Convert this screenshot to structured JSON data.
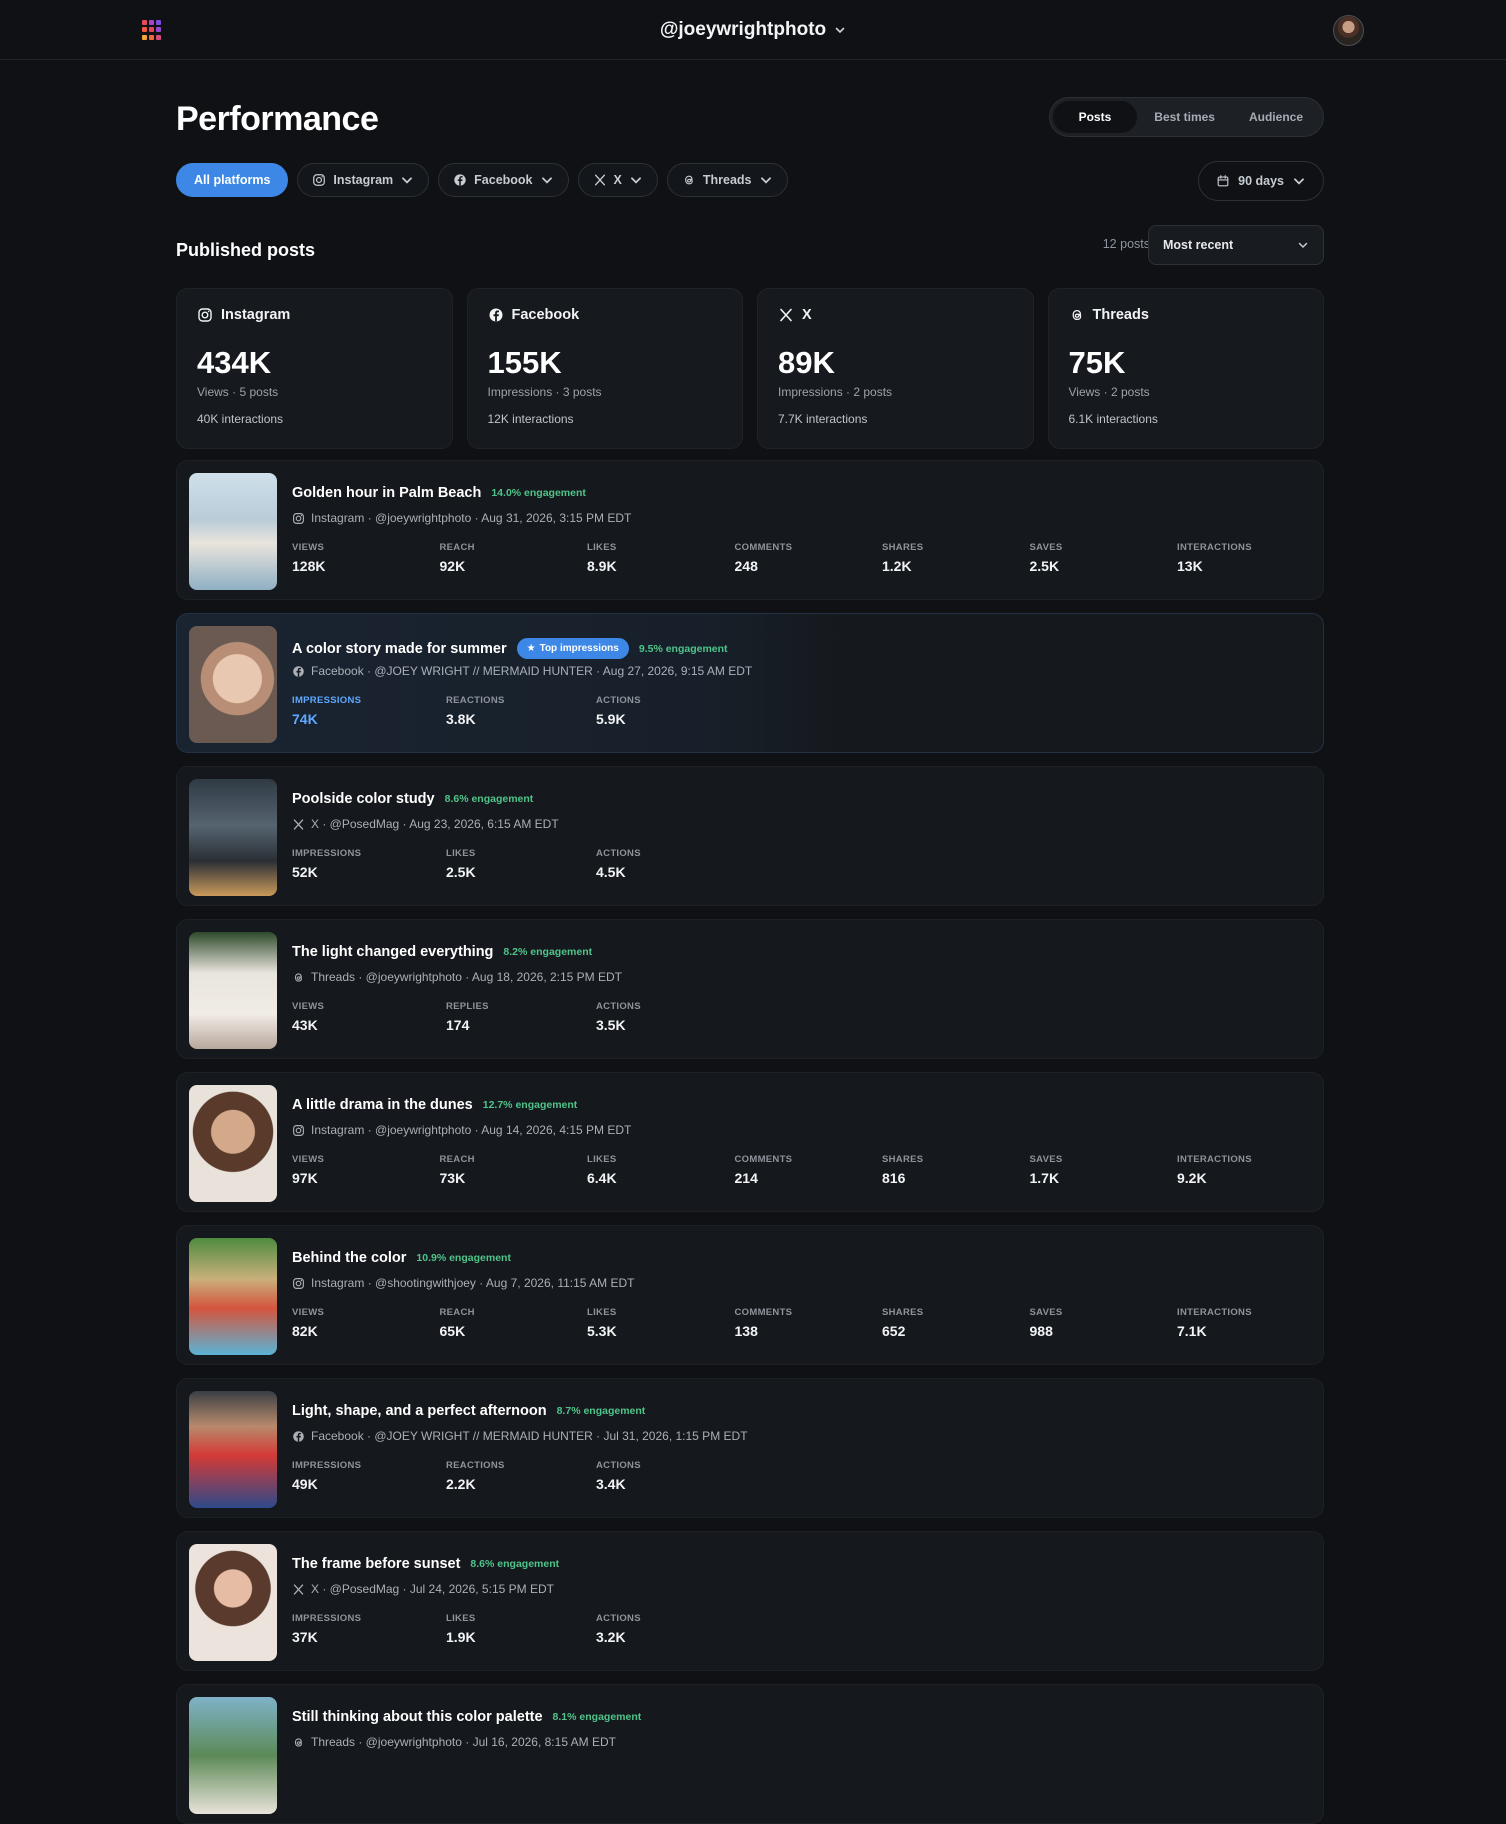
{
  "topbar": {
    "account": "@joeywrightphoto",
    "grid_colors": [
      "#e94a5b",
      "#a646c8",
      "#7a4de0",
      "#f1573f",
      "#e6425a",
      "#9847cf",
      "#f5a43a",
      "#ee6a3a",
      "#d9497a"
    ]
  },
  "page": {
    "title": "Performance",
    "tabs": [
      "Posts",
      "Best times",
      "Audience"
    ],
    "active_tab": "Posts",
    "filters": {
      "all": "All platforms",
      "instagram": "Instagram",
      "facebook": "Facebook",
      "x": "X",
      "threads": "Threads"
    },
    "date_range": "90 days",
    "section_title": "Published posts",
    "post_count": "12 posts",
    "sort": "Most recent"
  },
  "colors": {
    "accent": "#3d88e6",
    "engagement": "#4fc48a",
    "highlight": "#5ea8ff"
  },
  "summary": [
    {
      "platform": "Instagram",
      "icon": "instagram-icon",
      "value": "434K",
      "sub": "Views · 5 posts",
      "interactions": "40K interactions"
    },
    {
      "platform": "Facebook",
      "icon": "facebook-icon",
      "value": "155K",
      "sub": "Impressions · 3 posts",
      "interactions": "12K interactions"
    },
    {
      "platform": "X",
      "icon": "x-icon",
      "value": "89K",
      "sub": "Impressions · 2 posts",
      "interactions": "7.7K interactions"
    },
    {
      "platform": "Threads",
      "icon": "threads-icon",
      "value": "75K",
      "sub": "Views · 2 posts",
      "interactions": "6.1K interactions"
    }
  ],
  "posts": [
    {
      "title": "Golden hour in Palm Beach",
      "engagement": "14.0% engagement",
      "badge": "",
      "platform": "instagram",
      "meta": "Instagram · @joeywrightphoto · Aug 31, 2026, 3:15 PM EDT",
      "metrics": [
        [
          "VIEWS",
          "128K"
        ],
        [
          "REACH",
          "92K"
        ],
        [
          "LIKES",
          "8.9K"
        ],
        [
          "COMMENTS",
          "248"
        ],
        [
          "SHARES",
          "1.2K"
        ],
        [
          "SAVES",
          "2.5K"
        ],
        [
          "INTERACTIONS",
          "13K"
        ]
      ]
    },
    {
      "title": "A color story made for summer",
      "engagement": "9.5% engagement",
      "badge": "Top impressions",
      "platform": "facebook",
      "meta": "Facebook · @JOEY WRIGHT // MERMAID HUNTER · Aug 27, 2026, 9:15 AM EDT",
      "metrics": [
        [
          "IMPRESSIONS",
          "74K"
        ],
        [
          "REACTIONS",
          "3.8K"
        ],
        [
          "ACTIONS",
          "5.9K"
        ]
      ]
    },
    {
      "title": "Poolside color study",
      "engagement": "8.6% engagement",
      "badge": "",
      "platform": "x",
      "meta": "X · @PosedMag · Aug 23, 2026, 6:15 AM EDT",
      "metrics": [
        [
          "IMPRESSIONS",
          "52K"
        ],
        [
          "LIKES",
          "2.5K"
        ],
        [
          "ACTIONS",
          "4.5K"
        ]
      ]
    },
    {
      "title": "The light changed everything",
      "engagement": "8.2% engagement",
      "badge": "",
      "platform": "threads",
      "meta": "Threads · @joeywrightphoto · Aug 18, 2026, 2:15 PM EDT",
      "metrics": [
        [
          "VIEWS",
          "43K"
        ],
        [
          "REPLIES",
          "174"
        ],
        [
          "ACTIONS",
          "3.5K"
        ]
      ]
    },
    {
      "title": "A little drama in the dunes",
      "engagement": "12.7% engagement",
      "badge": "",
      "platform": "instagram",
      "meta": "Instagram · @joeywrightphoto · Aug 14, 2026, 4:15 PM EDT",
      "metrics": [
        [
          "VIEWS",
          "97K"
        ],
        [
          "REACH",
          "73K"
        ],
        [
          "LIKES",
          "6.4K"
        ],
        [
          "COMMENTS",
          "214"
        ],
        [
          "SHARES",
          "816"
        ],
        [
          "SAVES",
          "1.7K"
        ],
        [
          "INTERACTIONS",
          "9.2K"
        ]
      ]
    },
    {
      "title": "Behind the color",
      "engagement": "10.9% engagement",
      "badge": "",
      "platform": "instagram",
      "meta": "Instagram · @shootingwithjoey · Aug 7, 2026, 11:15 AM EDT",
      "metrics": [
        [
          "VIEWS",
          "82K"
        ],
        [
          "REACH",
          "65K"
        ],
        [
          "LIKES",
          "5.3K"
        ],
        [
          "COMMENTS",
          "138"
        ],
        [
          "SHARES",
          "652"
        ],
        [
          "SAVES",
          "988"
        ],
        [
          "INTERACTIONS",
          "7.1K"
        ]
      ]
    },
    {
      "title": "Light, shape, and a perfect afternoon",
      "engagement": "8.7% engagement",
      "badge": "",
      "platform": "facebook",
      "meta": "Facebook · @JOEY WRIGHT // MERMAID HUNTER · Jul 31, 2026, 1:15 PM EDT",
      "metrics": [
        [
          "IMPRESSIONS",
          "49K"
        ],
        [
          "REACTIONS",
          "2.2K"
        ],
        [
          "ACTIONS",
          "3.4K"
        ]
      ]
    },
    {
      "title": "The frame before sunset",
      "engagement": "8.6% engagement",
      "badge": "",
      "platform": "x",
      "meta": "X · @PosedMag · Jul 24, 2026, 5:15 PM EDT",
      "metrics": [
        [
          "IMPRESSIONS",
          "37K"
        ],
        [
          "LIKES",
          "1.9K"
        ],
        [
          "ACTIONS",
          "3.2K"
        ]
      ]
    },
    {
      "title": "Still thinking about this color palette",
      "engagement": "8.1% engagement",
      "badge": "",
      "platform": "threads",
      "meta": "Threads · @joeywrightphoto · Jul 16, 2026, 8:15 AM EDT",
      "metrics": []
    }
  ]
}
